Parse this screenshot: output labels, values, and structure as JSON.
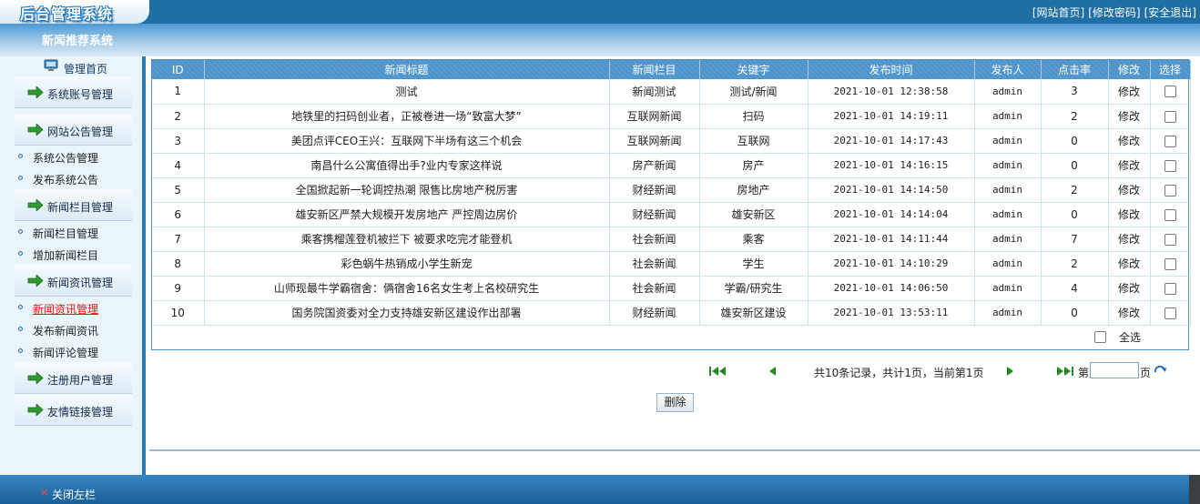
{
  "header": {
    "logo": "后台管理系统",
    "links": [
      "[网站首页]",
      "[修改密码]",
      "[安全退出]"
    ]
  },
  "subheader": {
    "title": "新闻推荐系统"
  },
  "sidebar": {
    "home": "管理首页",
    "groups": [
      {
        "label": "系统账号管理",
        "items": []
      },
      {
        "label": "网站公告管理",
        "items": [
          "系统公告管理",
          "发布系统公告"
        ]
      },
      {
        "label": "新闻栏目管理",
        "items": [
          "新闻栏目管理",
          "增加新闻栏目"
        ]
      },
      {
        "label": "新闻资讯管理",
        "items": [
          "新闻资讯管理",
          "发布新闻资讯",
          "新闻评论管理"
        ]
      },
      {
        "label": "注册用户管理",
        "items": []
      },
      {
        "label": "友情链接管理",
        "items": []
      }
    ],
    "active_item": "新闻资讯管理"
  },
  "table": {
    "columns": [
      "ID",
      "新闻标题",
      "新闻栏目",
      "关键字",
      "发布时间",
      "发布人",
      "点击率",
      "修改",
      "选择"
    ],
    "rows": [
      [
        "1",
        "测试",
        "新闻测试",
        "测试/新闻",
        "2021-10-01 12:38:58",
        "admin",
        "3",
        "修改"
      ],
      [
        "2",
        "地铁里的扫码创业者，正被卷进一场“致富大梦”",
        "互联网新闻",
        "扫码",
        "2021-10-01 14:19:11",
        "admin",
        "2",
        "修改"
      ],
      [
        "3",
        "美团点评CEO王兴：互联网下半场有这三个机会",
        "互联网新闻",
        "互联网",
        "2021-10-01 14:17:43",
        "admin",
        "0",
        "修改"
      ],
      [
        "4",
        "南昌什么公寓值得出手?业内专家这样说",
        "房产新闻",
        "房产",
        "2021-10-01 14:16:15",
        "admin",
        "0",
        "修改"
      ],
      [
        "5",
        "全国掀起新一轮调控热潮 限售比房地产税厉害",
        "财经新闻",
        "房地产",
        "2021-10-01 14:14:50",
        "admin",
        "2",
        "修改"
      ],
      [
        "6",
        "雄安新区严禁大规模开发房地产 严控周边房价",
        "财经新闻",
        "雄安新区",
        "2021-10-01 14:14:04",
        "admin",
        "0",
        "修改"
      ],
      [
        "7",
        "乘客携榴莲登机被拦下 被要求吃完才能登机",
        "社会新闻",
        "乘客",
        "2021-10-01 14:11:44",
        "admin",
        "7",
        "修改"
      ],
      [
        "8",
        "彩色蜗牛热销成小学生新宠",
        "社会新闻",
        "学生",
        "2021-10-01 14:10:29",
        "admin",
        "2",
        "修改"
      ],
      [
        "9",
        "山师现最牛学霸宿舍：俩宿舍16名女生考上名校研究生",
        "社会新闻",
        "学霸/研究生",
        "2021-10-01 14:06:50",
        "admin",
        "4",
        "修改"
      ],
      [
        "10",
        "国务院国资委对全力支持雄安新区建设作出部署",
        "财经新闻",
        "雄安新区建设",
        "2021-10-01 13:53:11",
        "admin",
        "0",
        "修改"
      ]
    ],
    "select_all_label": "全选"
  },
  "pager": {
    "info": "共10条记录，共计1页，当前第1页",
    "page_prefix": "第",
    "page_suffix": "页",
    "page_input_value": ""
  },
  "actions": {
    "delete_label": "删除"
  },
  "footer": {
    "close_sidebar_label": "关闭左栏"
  },
  "colors": {
    "topbar": "#1e6fa5",
    "table_header": "#4c93cb",
    "sidebar_bg": "#eaf4fb",
    "active_link": "#ee1111",
    "icon_green": "#2f9a2f"
  }
}
